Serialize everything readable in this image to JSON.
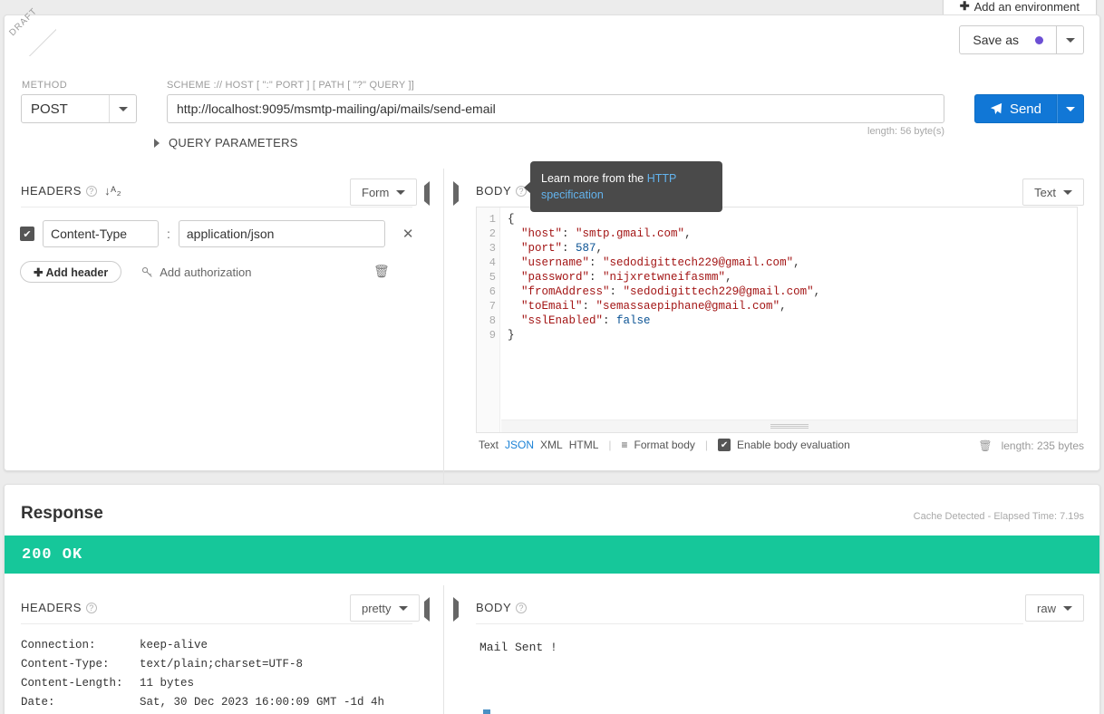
{
  "env_tab": {
    "label": "Add an environment",
    "plus": "✚"
  },
  "request": {
    "draft_ribbon": "DRAFT",
    "save_as": {
      "label": "Save as",
      "dot_color": "#6c4fd4"
    },
    "method": {
      "label": "METHOD",
      "value": "POST"
    },
    "url": {
      "label": "SCHEME :// HOST [ \":\" PORT ] [ PATH [ \"?\" QUERY ]]",
      "value": "http://localhost:9095/msmtp-mailing/api/mails/send-email",
      "length_note": "length: 56 byte(s)"
    },
    "send": {
      "label": "Send"
    },
    "query_parameters": {
      "label": "QUERY PARAMETERS"
    },
    "headers_panel": {
      "title": "HEADERS",
      "view_mode": "Form",
      "rows": [
        {
          "checked": "✔",
          "key": "Content-Type",
          "separator": ":",
          "value": "application/json",
          "remove": "✕"
        }
      ],
      "add_header": "✚ Add header",
      "add_authorization": "Add authorization"
    },
    "body_panel": {
      "title": "BODY",
      "view_mode": "Text",
      "tooltip": {
        "text": "Learn more from the ",
        "link": "HTTP specification"
      },
      "code_lines": [
        {
          "n": "1",
          "tokens": [
            {
              "t": "{",
              "c": "p"
            }
          ]
        },
        {
          "n": "2",
          "tokens": [
            {
              "t": "  \"host\"",
              "c": "k"
            },
            {
              "t": ": ",
              "c": "p"
            },
            {
              "t": "\"smtp.gmail.com\"",
              "c": "s"
            },
            {
              "t": ",",
              "c": "p"
            }
          ]
        },
        {
          "n": "3",
          "tokens": [
            {
              "t": "  \"port\"",
              "c": "k"
            },
            {
              "t": ": ",
              "c": "p"
            },
            {
              "t": "587",
              "c": "n"
            },
            {
              "t": ",",
              "c": "p"
            }
          ]
        },
        {
          "n": "4",
          "tokens": [
            {
              "t": "  \"username\"",
              "c": "k"
            },
            {
              "t": ": ",
              "c": "p"
            },
            {
              "t": "\"sedodigittech229@gmail.com\"",
              "c": "s"
            },
            {
              "t": ",",
              "c": "p"
            }
          ]
        },
        {
          "n": "5",
          "tokens": [
            {
              "t": "  \"password\"",
              "c": "k"
            },
            {
              "t": ": ",
              "c": "p"
            },
            {
              "t": "\"nijxretwneifasmm\"",
              "c": "s"
            },
            {
              "t": ",",
              "c": "p"
            }
          ]
        },
        {
          "n": "6",
          "tokens": [
            {
              "t": "  \"fromAddress\"",
              "c": "k"
            },
            {
              "t": ": ",
              "c": "p"
            },
            {
              "t": "\"sedodigittech229@gmail.com\"",
              "c": "s"
            },
            {
              "t": ",",
              "c": "p"
            }
          ]
        },
        {
          "n": "7",
          "tokens": [
            {
              "t": "  \"toEmail\"",
              "c": "k"
            },
            {
              "t": ": ",
              "c": "p"
            },
            {
              "t": "\"semassaepiphane@gmail.com\"",
              "c": "s"
            },
            {
              "t": ",",
              "c": "p"
            }
          ]
        },
        {
          "n": "8",
          "tokens": [
            {
              "t": "  \"sslEnabled\"",
              "c": "k"
            },
            {
              "t": ": ",
              "c": "p"
            },
            {
              "t": "false",
              "c": "b"
            }
          ]
        },
        {
          "n": "9",
          "tokens": [
            {
              "t": "}",
              "c": "p"
            }
          ]
        }
      ],
      "toolbar": {
        "formats": [
          "Text",
          "JSON",
          "XML",
          "HTML"
        ],
        "active_format": "JSON",
        "format_body": "Format body",
        "enable_body_evaluation": "Enable body evaluation",
        "length_note": "length: 235 bytes"
      }
    }
  },
  "response": {
    "title": "Response",
    "meta": "Cache Detected - Elapsed Time: 7.19s",
    "status": {
      "text": "200 OK",
      "color": "#16c79a"
    },
    "headers_panel": {
      "title": "HEADERS",
      "view_mode": "pretty",
      "rows": [
        {
          "key": "Connection:",
          "value": "keep-alive"
        },
        {
          "key": "Content-Type:",
          "value": "text/plain;charset=UTF-8"
        },
        {
          "key": "Content-Length:",
          "value": "11 bytes"
        },
        {
          "key": "Date:",
          "value": "Sat, 30 Dec 2023 16:00:09 GMT -1d 4h"
        }
      ]
    },
    "body_panel": {
      "title": "BODY",
      "view_mode": "raw",
      "content": "Mail Sent !"
    }
  }
}
